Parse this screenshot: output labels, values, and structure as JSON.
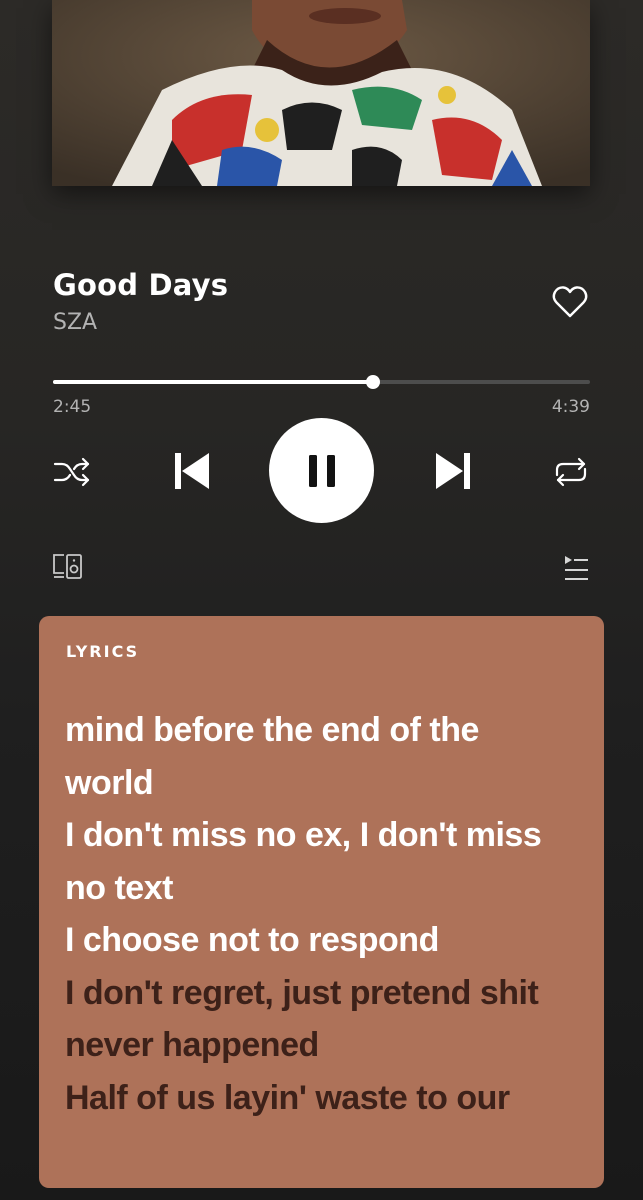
{
  "track": {
    "title": "Good Days",
    "artist": "SZA",
    "liked": false
  },
  "playback": {
    "elapsed": "2:45",
    "total": "4:39",
    "progress_fraction": 0.595,
    "state": "playing"
  },
  "controls": {
    "shuffle_icon": "shuffle-icon",
    "previous_icon": "skip-previous-icon",
    "pause_icon": "pause-icon",
    "next_icon": "skip-next-icon",
    "repeat_icon": "repeat-icon",
    "devices_icon": "devices-icon",
    "queue_icon": "queue-icon"
  },
  "lyrics": {
    "heading": "LYRICS",
    "lines": [
      "mind before the end of the",
      "world",
      "I don't miss no ex, I don't miss",
      "no text",
      "I choose not to respond",
      "I don't regret, just pretend shit",
      "never happened",
      "Half of us layin' waste to our"
    ],
    "past_line_count": 5
  },
  "colors": {
    "lyrics_card": "#ae7259",
    "lyrics_past": "#ffffff",
    "lyrics_upcoming": "#3d2119",
    "secondary_text": "#b3b3b3",
    "accent": "#ffffff"
  }
}
